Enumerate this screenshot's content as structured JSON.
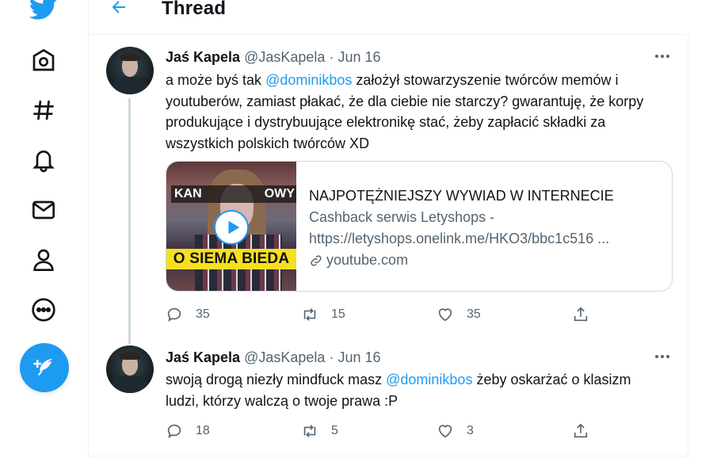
{
  "nav": {
    "icons": [
      "twitter-bird-icon",
      "home-icon",
      "explore-hashtag-icon",
      "notifications-bell-icon",
      "messages-envelope-icon",
      "profile-person-icon",
      "more-circle-icon",
      "compose-feather-icon"
    ]
  },
  "header": {
    "title": "Thread"
  },
  "tweets": [
    {
      "author_name": "Jaś Kapela",
      "handle": "@JasKapela",
      "separator": "·",
      "date": "Jun 16",
      "text_before": "a może byś tak ",
      "mention": "@dominikbos",
      "text_after": " założył stowarzyszenie twórców memów i youtuberów, zamiast płakać, że dla ciebie nie starczy? gwarantuję, że korpy produkujące i dystrybuujące elektronikę stać, żeby zapłacić składki za wszystkich polskich twórców XD",
      "card": {
        "thumbnail_band_text": "O SIEMA BIEDA",
        "thumbnail_top_left": "KAN",
        "thumbnail_top_right": "OWY",
        "title": "NAJPOTĘŻNIEJSZY WYWIAD W INTERNECIE",
        "desc_line1": "Cashback serwis Letyshops -",
        "desc_line2": "https://letyshops.onelink.me/HKO3/bbc1c516 ...",
        "domain": "youtube.com"
      },
      "replies": "35",
      "retweets": "15",
      "likes": "35"
    },
    {
      "author_name": "Jaś Kapela",
      "handle": "@JasKapela",
      "separator": "·",
      "date": "Jun 16",
      "text_before": "swoją drogą niezły mindfuck masz ",
      "mention": "@dominikbos",
      "text_after": " żeby oskarżać o klasizm ludzi, którzy walczą o twoje prawa :P",
      "replies": "18",
      "retweets": "5",
      "likes": "3"
    }
  ],
  "colors": {
    "accent": "#1d9bf0",
    "text": "#0f1419",
    "secondary": "#536471",
    "border": "#cfd9de"
  }
}
